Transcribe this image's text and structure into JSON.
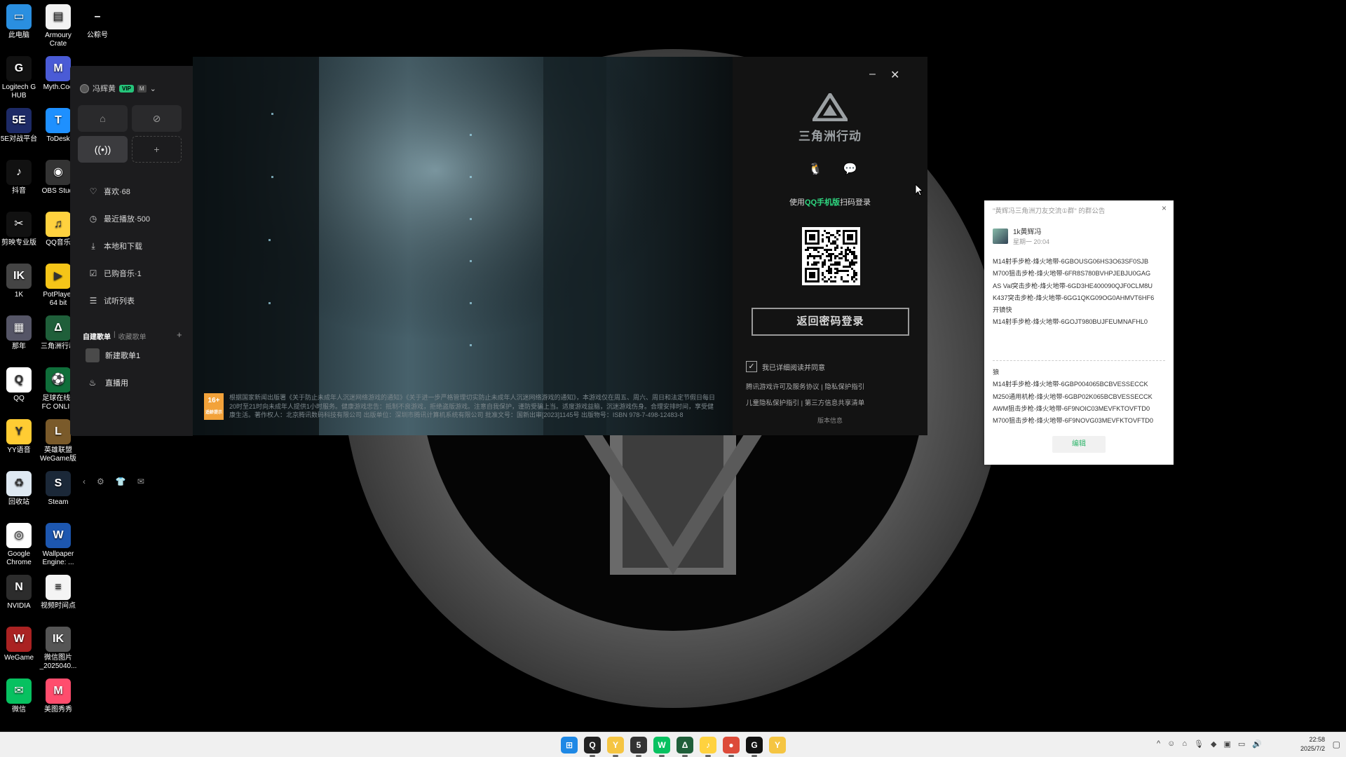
{
  "desktop_icons": [
    {
      "label": "此电脑",
      "icon": "monitor-icon",
      "color": "#2a8fe0"
    },
    {
      "label": "Armoury\nCrate",
      "icon": "document-icon",
      "color": "#f2f2f2"
    },
    {
      "label": "公粽号",
      "icon": "blank-file-icon",
      "color": "transparent"
    },
    {
      "label": "Logitech G\nHUB",
      "icon": "logitech-icon",
      "color": "#111"
    },
    {
      "label": "Myth.Coo",
      "icon": "myth-icon",
      "color": "#4a5bd6"
    },
    {
      "label": "5E对战平台",
      "icon": "5e-icon",
      "color": "#1d2a66"
    },
    {
      "label": "ToDesk",
      "icon": "todesk-icon",
      "color": "#1e90ff"
    },
    {
      "label": "抖音",
      "icon": "douyin-icon",
      "color": "#111"
    },
    {
      "label": "OBS Studi",
      "icon": "obs-icon",
      "color": "#333"
    },
    {
      "label": "剪映专业版",
      "icon": "jianying-icon",
      "color": "#111"
    },
    {
      "label": "QQ音乐",
      "icon": "qqmusic-icon",
      "color": "#ffd23f"
    },
    {
      "label": "1K",
      "icon": "1k-icon",
      "color": "#444"
    },
    {
      "label": "PotPlayer\n64 bit",
      "icon": "potplayer-icon",
      "color": "#f5c518"
    },
    {
      "label": "那年",
      "icon": "photo-icon",
      "color": "#556"
    },
    {
      "label": "三角洲行动",
      "icon": "delta-icon",
      "color": "#1f5f3a"
    },
    {
      "label": "QQ",
      "icon": "qq-icon",
      "color": "#fff"
    },
    {
      "label": "足球在线4\nFC ONLIN",
      "icon": "fc-icon",
      "color": "#0f6e3a"
    },
    {
      "label": "YY语音",
      "icon": "yy-icon",
      "color": "#ffcc33"
    },
    {
      "label": "英雄联盟\nWeGame版",
      "icon": "lol-icon",
      "color": "#7a5a2a"
    },
    {
      "label": "回收站",
      "icon": "recycle-bin-icon",
      "color": "#dfe9f2"
    },
    {
      "label": "Steam",
      "icon": "steam-icon",
      "color": "#1b2838"
    },
    {
      "label": "Google\nChrome",
      "icon": "chrome-icon",
      "color": "#fff"
    },
    {
      "label": "Wallpaper\nEngine: ...",
      "icon": "wallpaper-engine-icon",
      "color": "#1d57b0"
    },
    {
      "label": "NVIDIA",
      "icon": "nvidia-icon",
      "color": "#2c2c2c"
    },
    {
      "label": "视频时间点",
      "icon": "text-file-icon",
      "color": "#f4f4f4"
    },
    {
      "label": "WeGame",
      "icon": "wegame-icon",
      "color": "#a22"
    },
    {
      "label": "微信图片\n_2025040...",
      "icon": "image-file-icon",
      "color": "#555"
    },
    {
      "label": "微信",
      "icon": "wechat-icon",
      "color": "#07c160"
    },
    {
      "label": "美图秀秀",
      "icon": "meitu-icon",
      "color": "#ff4d6d"
    }
  ],
  "music_app": {
    "username": "冯辉黄",
    "vip_badge": "VIP",
    "vip_level": "M",
    "menu": [
      {
        "label": "喜欢·68",
        "icon": "heart-icon"
      },
      {
        "label": "最近播放·500",
        "icon": "clock-icon"
      },
      {
        "label": "本地和下载",
        "icon": "download-icon"
      },
      {
        "label": "已购音乐·1",
        "icon": "purchased-icon"
      },
      {
        "label": "试听列表",
        "icon": "list-icon"
      }
    ],
    "tabs": {
      "created": "自建歌单",
      "sep": "|",
      "collected": "收藏歌单"
    },
    "playlists": [
      {
        "label": "新建歌单1"
      },
      {
        "label": "直播用"
      }
    ]
  },
  "launcher": {
    "game_logo_text": "三角洲行动",
    "scan_prefix": "使用",
    "scan_highlight": "QQ手机版",
    "scan_suffix": "扫码登录",
    "password_login": "返回密码登录",
    "agree_text": "我已详细阅读并同意",
    "links_line1": "腾讯游戏许可及服务协议 | 隐私保护指引",
    "links_line2": "儿童隐私保护指引 | 第三方信息共享清单",
    "version_info": "版本信息",
    "age_badge": "16+",
    "age_badge_sub": "适龄提示",
    "notice_text": "根据国家新闻出版署《关于防止未成年人沉迷网络游戏的通知》《关于进一步严格管理切实防止未成年人沉迷网络游戏的通知》，本游戏仅在周五、周六、周日和法定节假日每日20时至21时向未成年人提供1小时服务。健康游戏忠告：抵制不良游戏，拒绝盗版游戏。注意自我保护，谨防受骗上当。适度游戏益脑，沉迷游戏伤身。合理安排时间，享受健康生活。著作权人：北京腾讯数码科技有限公司 出版单位：深圳市腾讯计算机系统有限公司 批准文号：国新出审[2023]1145号 出版物号：ISBN 978-7-498-12483-8",
    "accent_color": "#2fd780"
  },
  "notice_popup": {
    "title": "\"黄辉冯三角洲刀友交流①群\" 的群公告",
    "author": "1k黄辉冯",
    "time": "星期一 20:04",
    "lines_top": [
      "M14射手步枪-烽火地带-6GBOUSG06HS3O63SF0SJB",
      "M700狙击步枪-烽火地带-6FR8S780BVHPJEBJU0GAG",
      "AS Val突击步枪-烽火地带-6GD3HE400090QJF0CLM8U",
      "K437突击步枪-烽火地带-6GG1QKG09OG0AHMVT6HF6",
      "开镜快",
      "M14射手步枪-烽火地带-6GOJT980BUJFEUMNAFHL0"
    ],
    "lines_bottom": [
      "狼",
      "M14射手步枪-烽火地带-6GBP004065BCBVESSECCK",
      "M250通用机枪-烽火地带-6GBP02K065BCBVESSECCK",
      "AWM狙击步枪-烽火地带-6F9NOIC03MEVFKTOVFTD0",
      "M700狙击步枪-烽火地带-6F9NOVG03MEVFKTOVFTD0"
    ],
    "edit_label": "编辑",
    "close_label": "×"
  },
  "taskbar": {
    "apps": [
      {
        "icon": "windows-start-icon",
        "color": "#1e88e5",
        "glyph": "⊞"
      },
      {
        "icon": "qq-icon",
        "color": "#222",
        "glyph": "Q"
      },
      {
        "icon": "yy-icon",
        "color": "#f5c542",
        "glyph": "Y"
      },
      {
        "icon": "5e-icon",
        "color": "#333",
        "glyph": "5"
      },
      {
        "icon": "wechat-icon",
        "color": "#07c160",
        "glyph": "W"
      },
      {
        "icon": "delta-icon",
        "color": "#1f5f3a",
        "glyph": "Δ"
      },
      {
        "icon": "qqmusic-icon",
        "color": "#ffd23f",
        "glyph": "♪"
      },
      {
        "icon": "chrome-icon",
        "color": "#dd4b39",
        "glyph": "●"
      },
      {
        "icon": "logitech-icon",
        "color": "#111",
        "glyph": "G"
      },
      {
        "icon": "yy-voice-icon",
        "color": "#f5c542",
        "glyph": "Y"
      }
    ],
    "time": "22:58",
    "date": "2025/7/2"
  }
}
